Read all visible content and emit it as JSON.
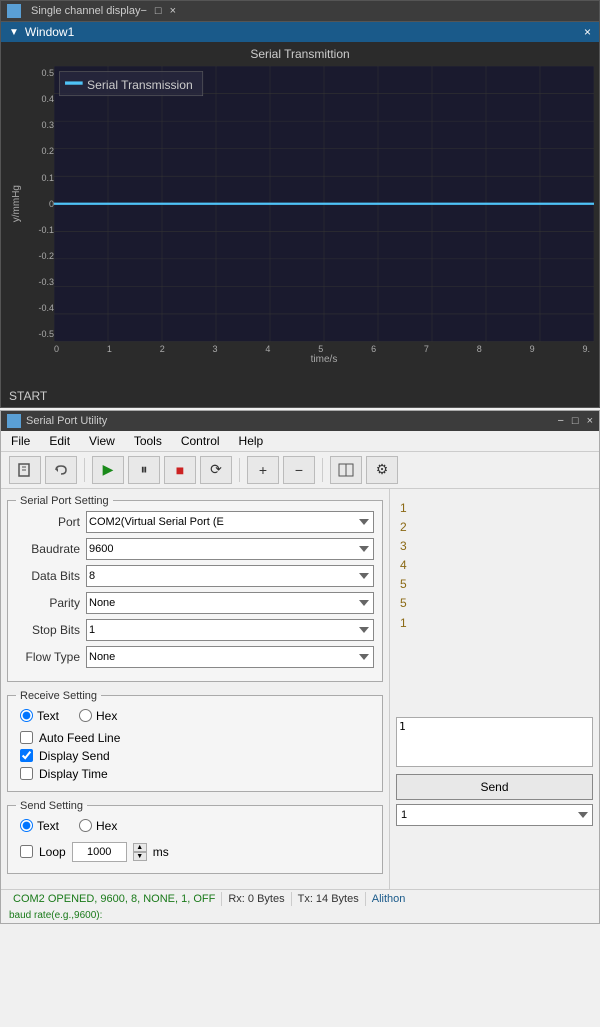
{
  "topWindow": {
    "titleBar": "Single channel display",
    "window1Label": "Window1",
    "closeBtn": "×",
    "chartTitle": "Serial Transmittion",
    "legend": "Serial Transmission",
    "yAxisLabel": "y/mmHg",
    "xAxisLabel": "time/s",
    "yTicks": [
      "0.5",
      "0.4",
      "0.3",
      "0.2",
      "0.1",
      "0",
      "-0.1",
      "-0.2",
      "-0.3",
      "-0.4",
      "-0.5"
    ],
    "xTicks": [
      "0",
      "1",
      "2",
      "3",
      "4",
      "5",
      "6",
      "7",
      "8",
      "9",
      "9."
    ],
    "startLabel": "START"
  },
  "bottomWindow": {
    "titleBar": "Serial Port Utility",
    "menuItems": [
      "File",
      "Edit",
      "View",
      "Tools",
      "Control",
      "Help"
    ],
    "titleControls": [
      "−",
      "□",
      "×"
    ],
    "serialPortSetting": {
      "legend": "Serial Port Setting",
      "portLabel": "Port",
      "portValue": "COM2(Virtual Serial Port (E",
      "baudrateLabel": "Baudrate",
      "baudrateValue": "9600",
      "dataBitsLabel": "Data Bits",
      "dataBitsValue": "8",
      "parityLabel": "Parity",
      "parityValue": "None",
      "stopBitsLabel": "Stop Bits",
      "stopBitsValue": "1",
      "flowTypeLabel": "Flow Type",
      "flowTypeValue": "None"
    },
    "receiveSetting": {
      "legend": "Receive Setting",
      "textLabel": "Text",
      "hexLabel": "Hex",
      "autoFeedLine": "Auto Feed Line",
      "displaySend": "Display Send",
      "displayTime": "Display Time"
    },
    "sendSetting": {
      "legend": "Send Setting",
      "textLabel": "Text",
      "hexLabel": "Hex",
      "loopLabel": "Loop",
      "loopValue": "1000",
      "msLabel": "ms"
    },
    "rightNumbers": [
      "1",
      "2",
      "3",
      "4",
      "5",
      "5",
      "1"
    ],
    "sendTextValue": "1",
    "sendButton": "Send",
    "rightSelectValue": "1",
    "statusCom": "COM2 OPENED, 9600, 8, NONE, 1, OFF",
    "statusRx": "Rx: 0 Bytes",
    "statusTx": "Tx: 14 Bytes",
    "statusAlithon": "Alithon",
    "statusBaud": "baud rate(e.g.,9600):"
  }
}
